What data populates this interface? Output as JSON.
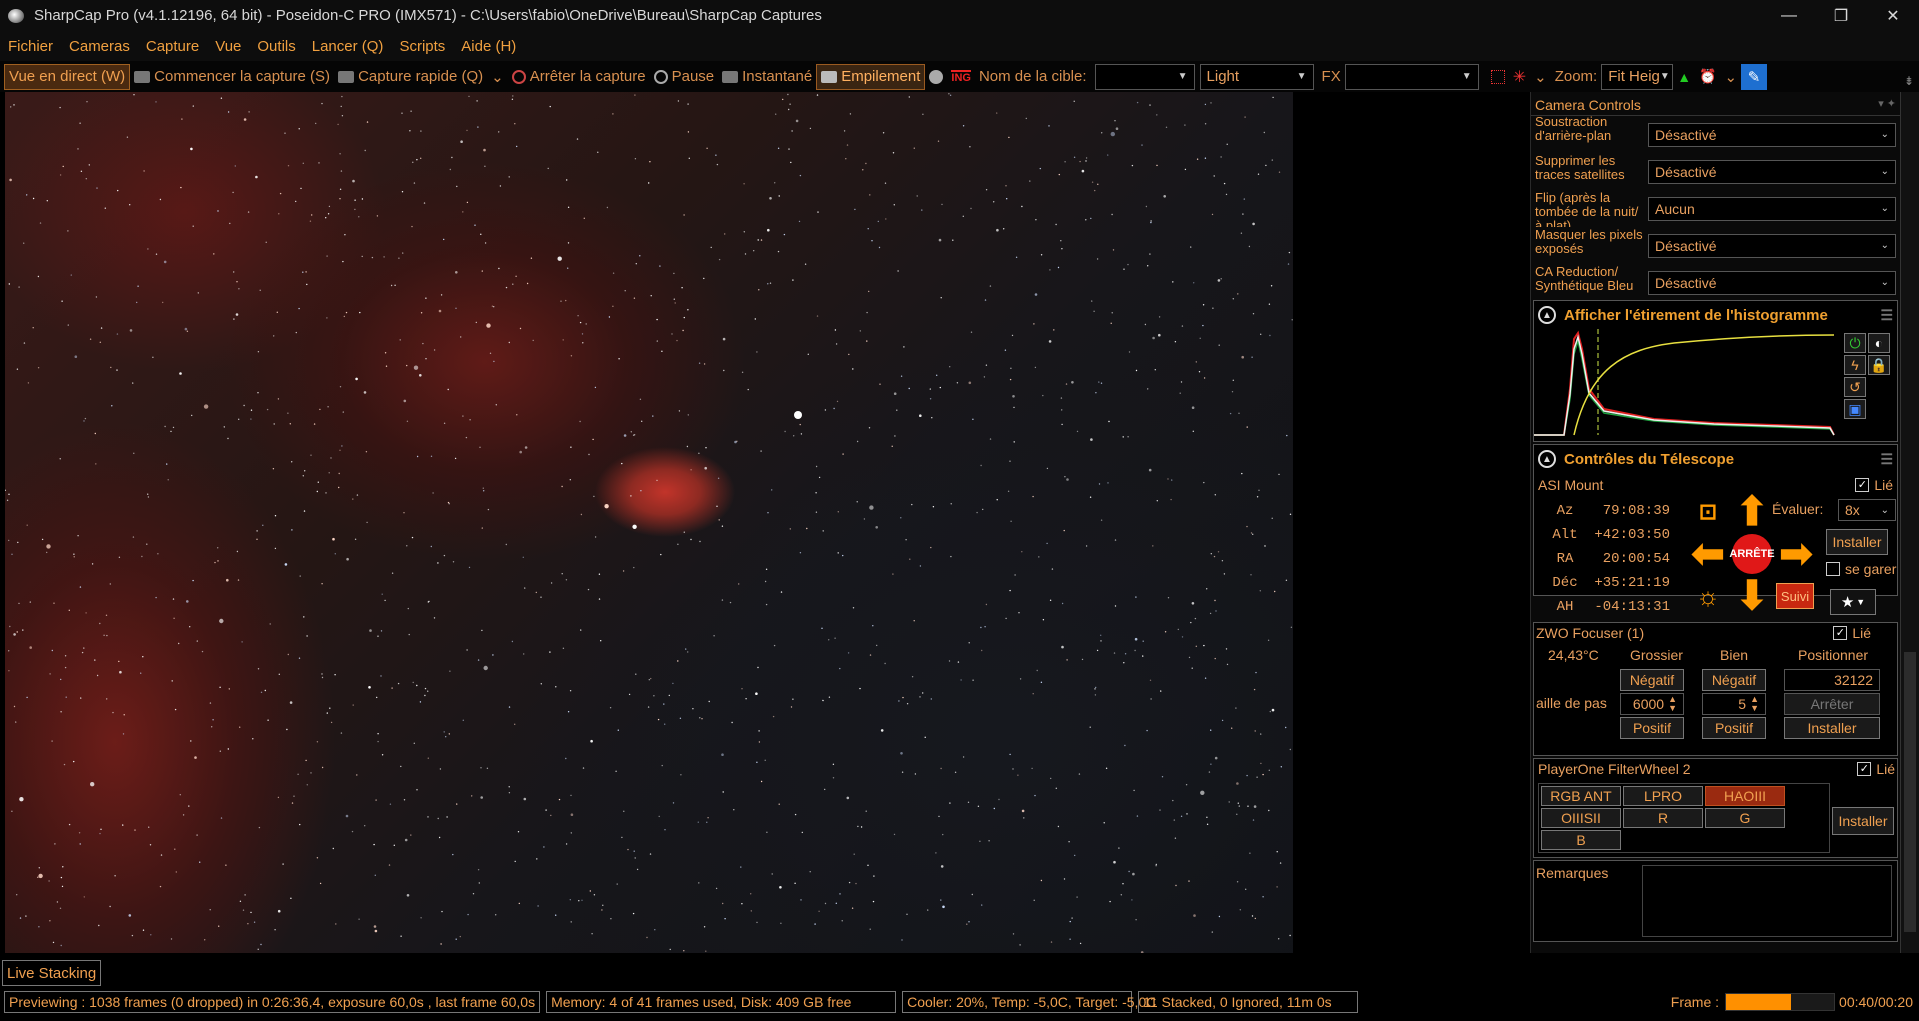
{
  "window": {
    "title": "SharpCap Pro (v4.1.12196, 64 bit) - Poseidon-C PRO (IMX571) - C:\\Users\\fabio\\OneDrive\\Bureau\\SharpCap Captures"
  },
  "menu": [
    "Fichier",
    "Cameras",
    "Capture",
    "Vue",
    "Outils",
    "Lancer (Q)",
    "Scripts",
    "Aide (H)"
  ],
  "toolbar": {
    "live_view": "Vue en direct (W)",
    "start_capture": "Commencer la capture (S)",
    "quick_capture": "Capture rapide (Q)",
    "stop_capture": "Arrêter la capture",
    "pause": "Pause",
    "snapshot": "Instantané",
    "stacking": "Empilement",
    "target_label": "Nom de la cible:",
    "target_value": "",
    "frame_type": "Light",
    "fx_label": "FX",
    "fx_value": "",
    "zoom_label": "Zoom:",
    "zoom_value": "Fit Heig"
  },
  "camera_controls": {
    "title": "Camera Controls",
    "rows": [
      {
        "label": "Soustraction d'arrière-plan",
        "value": "Désactivé"
      },
      {
        "label": "Supprimer les traces satellites",
        "value": "Désactivé"
      },
      {
        "label": "Flip (après la tombée de la nuit/à plat)",
        "value": "Aucun"
      },
      {
        "label": "Masquer les pixels exposés",
        "value": "Désactivé"
      },
      {
        "label": "CA Reduction/ Synthétique Bleu",
        "value": "Désactivé"
      }
    ]
  },
  "histogram": {
    "title": "Afficher l'étirement de l'histogramme"
  },
  "telescope": {
    "title": "Contrôles du Télescope",
    "mount_name": "ASI Mount",
    "linked_label": "Lié",
    "coords": [
      {
        "label": "Az",
        "value": "79:08:39"
      },
      {
        "label": "Alt",
        "value": "+42:03:50"
      },
      {
        "label": "RA",
        "value": "20:00:54"
      },
      {
        "label": "Déc",
        "value": "+35:21:19"
      },
      {
        "label": "AH",
        "value": "-04:13:31"
      }
    ],
    "rate_label": "Évaluer:",
    "rate_value": "8x",
    "install_label": "Installer",
    "park_label": "se garer",
    "stop_label": "ARRÊTE",
    "tracking_label": "Suivi"
  },
  "focuser": {
    "title": "ZWO Focuser (1)",
    "linked_label": "Lié",
    "temperature": "24,43°C",
    "col_coarse": "Grossier",
    "col_fine": "Bien",
    "col_position": "Positionner",
    "negative_label": "Négatif",
    "positive_label": "Positif",
    "position_value": "32122",
    "step_label": "aille de pas",
    "coarse_step": "6000",
    "fine_step": "5",
    "stop_label": "Arrêter",
    "install_label": "Installer"
  },
  "filterwheel": {
    "title": "PlayerOne FilterWheel 2",
    "linked_label": "Lié",
    "filters": [
      "RGB ANT",
      "LPRO",
      "HAOIII",
      "OIIISII",
      "R",
      "G",
      "B"
    ],
    "selected": "HAOIII",
    "install_label": "Installer"
  },
  "notes": {
    "label": "Remarques"
  },
  "live_stacking_tab": "Live Stacking",
  "status": {
    "previewing": "Previewing : 1038 frames (0 dropped) in 0:26:36,4, exposure 60,0s , last frame 60,0s",
    "memory": "Memory: 4 of 41 frames used, Disk: 409 GB free",
    "cooler": "Cooler: 20%, Temp: -5,0C, Target: -5,0C",
    "stacked": "11 Stacked, 0 Ignored, 11m 0s",
    "frame_label": "Frame :",
    "frame_progress": 0.6,
    "frame_time": "00:40/00:20"
  },
  "colors": {
    "accent": "#f0a050",
    "active": "#ff9a00",
    "stop": "#e01818",
    "selected_filter": "#9a2a10"
  }
}
